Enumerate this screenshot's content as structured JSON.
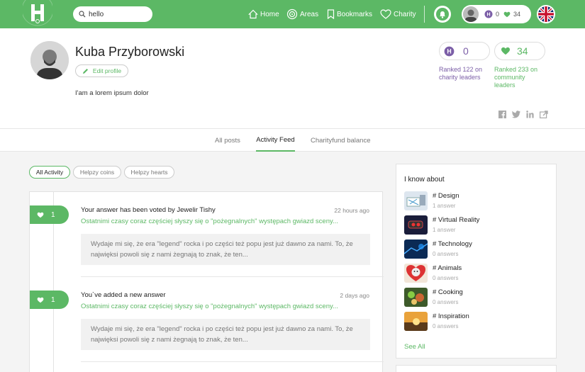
{
  "header": {
    "logo_letter": "H",
    "search": {
      "value": "hello",
      "placeholder": ""
    },
    "nav": [
      {
        "label": "Home",
        "icon": "home-icon"
      },
      {
        "label": "Areas",
        "icon": "target-icon"
      },
      {
        "label": "Bookmarks",
        "icon": "bookmark-icon"
      },
      {
        "label": "Charity",
        "icon": "heart-outline-icon"
      }
    ],
    "user_coins": "0",
    "user_hearts": "34"
  },
  "profile": {
    "name": "Kuba Przyborowski",
    "edit_label": "Edit profile",
    "bio": "I'am a lorem ipsum dolor",
    "coins": "0",
    "hearts": "34",
    "charity_rank": "Ranked 122 on charity leaders",
    "community_rank": "Ranked 233 on community leaders"
  },
  "tabs": [
    "All posts",
    "Activity Feed",
    "Charityfund balance"
  ],
  "filters": [
    "All Activity",
    "Helpzy coins",
    "Helpzy hearts"
  ],
  "feed": [
    {
      "votes": "1",
      "title_prefix": "Your answer has been voted by ",
      "title_user": "Jewelir Tishy",
      "time": "22 hours ago",
      "question": "Ostatnimi czasy coraz częściej słyszy się o \"pożegnalnych\" występach gwiazd sceny...",
      "excerpt": "Wydaje mi się, że era \"legend\" rocka i po części też popu jest już dawno za nami. To, że najwięksi powoli się z nami żegnają to znak, że ten..."
    },
    {
      "votes": "1",
      "title_prefix": "You`ve added a new answer",
      "title_user": "",
      "time": "2 days ago",
      "question": "Ostatnimi czasy coraz częściej słyszy się o \"pożegnalnych\" występach gwiazd sceny...",
      "excerpt": "Wydaje mi się, że era \"legend\" rocka i po części też popu jest już dawno za nami. To, że najwięksi powoli się z nami żegnają to znak, że ten..."
    }
  ],
  "sidebar": {
    "title": "I know about",
    "topics": [
      {
        "name": "# Design",
        "count": "1 answer"
      },
      {
        "name": "# Virtual Reality",
        "count": "1 answer"
      },
      {
        "name": "# Technology",
        "count": "0 answers"
      },
      {
        "name": "# Animals",
        "count": "0 answers"
      },
      {
        "name": "# Cooking",
        "count": "0 answers"
      },
      {
        "name": "# Inspiration",
        "count": "0 answers"
      }
    ],
    "see_all": "See All"
  },
  "colors": {
    "brand": "#5cb865",
    "coin": "#7b5ea7"
  }
}
